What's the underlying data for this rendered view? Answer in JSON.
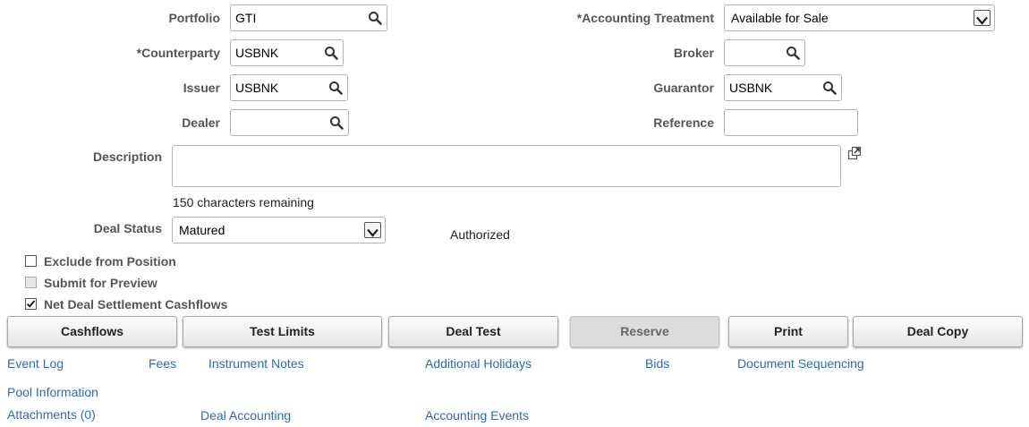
{
  "fields": {
    "portfolio": {
      "label": "Portfolio",
      "value": "GTI"
    },
    "accounting_treatment": {
      "label": "*Accounting Treatment",
      "value": "Available for Sale"
    },
    "counterparty": {
      "label": "*Counterparty",
      "value": "USBNK"
    },
    "broker": {
      "label": "Broker",
      "value": ""
    },
    "issuer": {
      "label": "Issuer",
      "value": "USBNK"
    },
    "guarantor": {
      "label": "Guarantor",
      "value": "USBNK"
    },
    "dealer": {
      "label": "Dealer",
      "value": ""
    },
    "reference": {
      "label": "Reference",
      "value": ""
    },
    "description": {
      "label": "Description",
      "value": "",
      "remaining": "150 characters remaining"
    },
    "deal_status": {
      "label": "Deal Status",
      "value": "Matured",
      "status_text": "Authorized"
    }
  },
  "checkboxes": [
    {
      "label": "Exclude from Position",
      "checked": false,
      "enabled": true
    },
    {
      "label": "Submit for Preview",
      "checked": false,
      "enabled": false
    },
    {
      "label": "Net Deal Settlement Cashflows",
      "checked": true,
      "enabled": true
    }
  ],
  "buttons": {
    "cashflows": "Cashflows",
    "test_limits": "Test Limits",
    "deal_test": "Deal Test",
    "reserve": "Reserve",
    "print": "Print",
    "deal_copy": "Deal Copy"
  },
  "links": {
    "event_log": "Event Log",
    "fees": "Fees",
    "instrument_notes": "Instrument Notes",
    "additional_holidays": "Additional Holidays",
    "bids": "Bids",
    "document_sequencing": "Document Sequencing",
    "pool_information": "Pool Information",
    "attachments": "Attachments (0)",
    "deal_accounting": "Deal Accounting",
    "accounting_events": "Accounting Events"
  },
  "icons": {
    "lookup": "magnifier-icon",
    "expand": "popup-expand-icon",
    "dropdown": "chevron-down-icon",
    "check": "checkmark-icon"
  },
  "colors": {
    "link": "#2a6cb8",
    "label": "#555555"
  }
}
